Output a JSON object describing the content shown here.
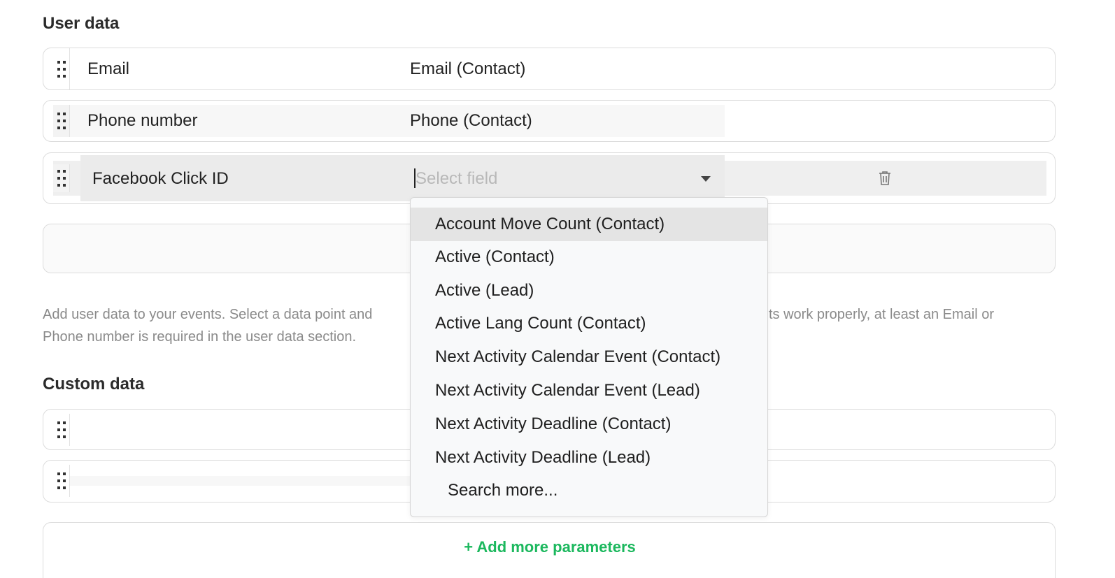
{
  "user_data": {
    "title": "User data",
    "rows": [
      {
        "label": "Email",
        "value": "Email (Contact)"
      },
      {
        "label": "Phone number",
        "value": "Phone (Contact)"
      },
      {
        "label": "Facebook Click ID",
        "placeholder": "Select field"
      }
    ],
    "help_text_left": "Add user data to your events. Select a data point and",
    "help_text_right": "ts work properly, at least an Email or",
    "help_text_line2": "Phone number is required in the user data section."
  },
  "custom_data": {
    "title": "Custom data",
    "add_more_label": "+ Add more parameters"
  },
  "dropdown": {
    "options": [
      "Account Move Count (Contact)",
      "Active (Contact)",
      "Active (Lead)",
      "Active Lang Count (Contact)",
      "Next Activity Calendar Event (Contact)",
      "Next Activity Calendar Event (Lead)",
      "Next Activity Deadline (Contact)",
      "Next Activity Deadline (Lead)"
    ],
    "search_more": "Search more..."
  },
  "icons": {
    "drag": "drag-handle-icon",
    "caret": "caret-down-icon",
    "trash": "trash-icon"
  },
  "colors": {
    "accent_green": "#1cb85e",
    "highlight": "#e4e4e4"
  }
}
